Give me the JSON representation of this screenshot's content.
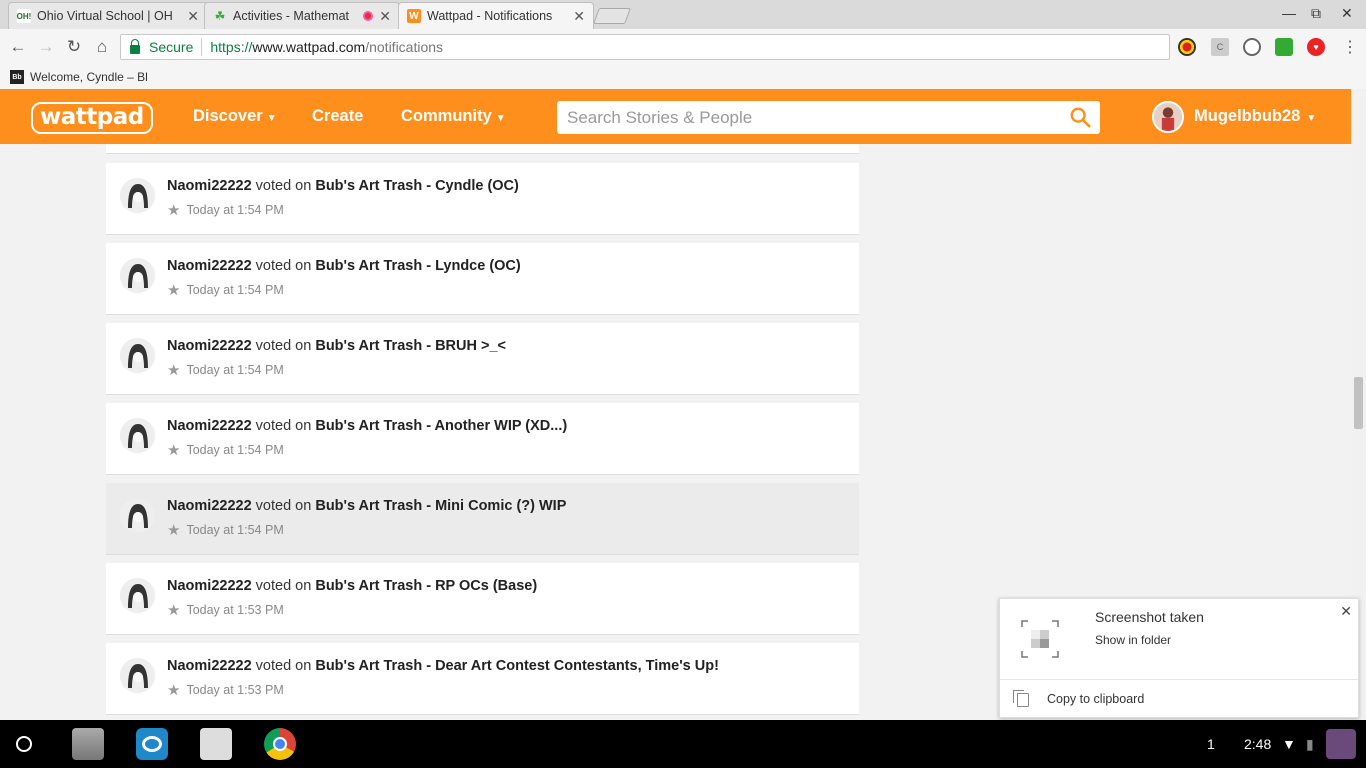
{
  "browser": {
    "tabs": [
      {
        "title": "Ohio Virtual School | OH",
        "favicon": "OH!",
        "active": false
      },
      {
        "title": "Activities - Mathemat",
        "favicon": "☘",
        "active": false,
        "recording": true
      },
      {
        "title": "Wattpad - Notifications",
        "favicon": "W",
        "active": true
      }
    ],
    "address": {
      "secure_label": "Secure",
      "scheme": "https://",
      "host": "www.wattpad.com",
      "path": "/notifications"
    },
    "bookmark": {
      "favicon": "Bb",
      "label": "Welcome, Cyndle – Bl"
    }
  },
  "header": {
    "logo": "wattpad",
    "nav": {
      "discover": "Discover",
      "create": "Create",
      "community": "Community"
    },
    "search_placeholder": "Search Stories & People",
    "username": "Mugelbbub28"
  },
  "notifications": [
    {
      "user": "Naomi22222",
      "action": "voted on",
      "story": "Bub's Art Trash - Cyndle (OC)",
      "time": "Today at 1:54 PM"
    },
    {
      "user": "Naomi22222",
      "action": "voted on",
      "story": "Bub's Art Trash - Lyndce (OC)",
      "time": "Today at 1:54 PM"
    },
    {
      "user": "Naomi22222",
      "action": "voted on",
      "story": "Bub's Art Trash - BRUH >_<",
      "time": "Today at 1:54 PM"
    },
    {
      "user": "Naomi22222",
      "action": "voted on",
      "story": "Bub's Art Trash - Another WIP (XD...)",
      "time": "Today at 1:54 PM"
    },
    {
      "user": "Naomi22222",
      "action": "voted on",
      "story": "Bub's Art Trash - Mini Comic (?) WIP",
      "time": "Today at 1:54 PM",
      "hovered": true
    },
    {
      "user": "Naomi22222",
      "action": "voted on",
      "story": "Bub's Art Trash - RP OCs (Base)",
      "time": "Today at 1:53 PM"
    },
    {
      "user": "Naomi22222",
      "action": "voted on",
      "story": "Bub's Art Trash - Dear Art Contest Contestants, Time's Up!",
      "time": "Today at 1:53 PM"
    }
  ],
  "toast": {
    "title": "Screenshot taken",
    "action": "Show in folder",
    "copy": "Copy to clipboard"
  },
  "shelf": {
    "notification_count": "1",
    "time": "2:48"
  },
  "colors": {
    "brand": "#ff8f1c",
    "secure": "#0b8043"
  }
}
